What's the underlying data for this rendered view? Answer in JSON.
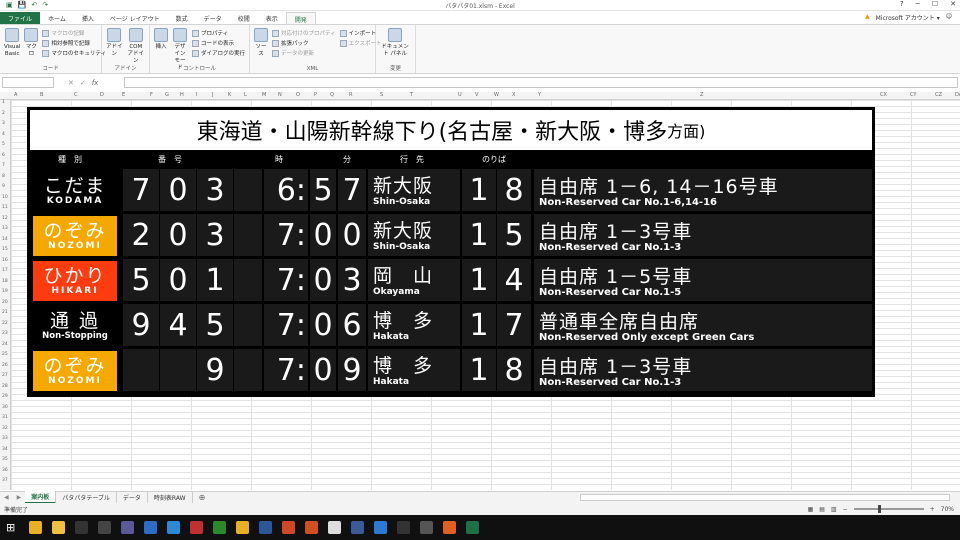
{
  "window": {
    "title": "パタパタ01.xlsm - Excel",
    "controls": [
      "?",
      "─",
      "☐",
      "✕"
    ]
  },
  "ribbon_tabs": [
    "ファイル",
    "ホーム",
    "挿入",
    "ページ レイアウト",
    "数式",
    "データ",
    "校閲",
    "表示",
    "開発"
  ],
  "account": {
    "warn": "▲",
    "label": "Microsoft アカウント ▾",
    "smiley": "☺"
  },
  "ribbon": {
    "code": {
      "label": "コード",
      "vb": "Visual Basic",
      "macro": "マクロ",
      "record": "マクロの記録",
      "relative": "相対参照で記録",
      "security": "マクロのセキュリティ"
    },
    "addin": {
      "label": "アドイン",
      "addin_btn": "アドイン",
      "com_btn": "COM アドイン"
    },
    "controls": {
      "label": "コントロール",
      "insert": "挿入",
      "design": "デザイン モード",
      "property": "プロパティ",
      "viewcode": "コードの表示",
      "dialog": "ダイアログの実行"
    },
    "xml": {
      "label": "XML",
      "source": "ソース",
      "mapprop": "対応付けのプロパティ",
      "expand": "拡張パック",
      "refresh": "データの更新",
      "import": "インポート",
      "export": "エクスポート"
    },
    "modify": {
      "label": "変更",
      "docpanel": "ドキュメント パネル"
    }
  },
  "formula_bar": {
    "fx": "fx",
    "cancel": "✕",
    "enter": "✓"
  },
  "columns": [
    "A",
    "B",
    "C",
    "D",
    "E",
    "F",
    "G",
    "H",
    "I",
    "J",
    "K",
    "L",
    "M",
    "N",
    "O",
    "P",
    "Q",
    "R",
    "S",
    "T",
    "U",
    "V",
    "W",
    "X",
    "Y",
    "Z",
    "CX",
    "CY",
    "CZ",
    "DA"
  ],
  "rows": [
    "1",
    "2",
    "3",
    "4",
    "5",
    "6",
    "7",
    "8",
    "9",
    "10",
    "11",
    "12",
    "13",
    "14",
    "15",
    "16",
    "17",
    "18",
    "19",
    "20",
    "21",
    "22",
    "23",
    "24",
    "25",
    "26",
    "27",
    "28",
    "29",
    "30",
    "31",
    "32",
    "33",
    "34",
    "35",
    "36",
    "37"
  ],
  "board": {
    "title": "東海道・山陽新幹線下り(名古屋・新大阪・博多",
    "title_suffix": "方面)",
    "headers": {
      "type": "種　別",
      "number": "番　号",
      "hour": "時",
      "minute": "分",
      "dest": "行　先",
      "track": "のりば"
    },
    "trains": [
      {
        "type_jp": "こだま",
        "type_en": "KODAMA",
        "type_color": "#000000",
        "num": [
          "7",
          "0",
          "3"
        ],
        "hour": "6:",
        "min": [
          "5",
          "7"
        ],
        "dest_jp": "新大阪",
        "dest_en": "Shin-Osaka",
        "track": [
          "1",
          "8"
        ],
        "car_jp": "自由席 1－6, 14－16号車",
        "car_en": "Non-Reserved Car No.1-6,14-16"
      },
      {
        "type_jp": "のぞみ",
        "type_en": "NOZOMI",
        "type_color": "#f5a800",
        "num": [
          "2",
          "0",
          "3"
        ],
        "hour": "7:",
        "min": [
          "0",
          "0"
        ],
        "dest_jp": "新大阪",
        "dest_en": "Shin-Osaka",
        "track": [
          "1",
          "5"
        ],
        "car_jp": "自由席 1－3号車",
        "car_en": "Non-Reserved Car No.1-3"
      },
      {
        "type_jp": "ひかり",
        "type_en": "HIKARI",
        "type_color": "#ff3b10",
        "num": [
          "5",
          "0",
          "1"
        ],
        "hour": "7:",
        "min": [
          "0",
          "3"
        ],
        "dest_jp": "岡　山",
        "dest_en": "Okayama",
        "track": [
          "1",
          "4"
        ],
        "car_jp": "自由席 1－5号車",
        "car_en": "Non-Reserved Car No.1-5"
      },
      {
        "type_jp": "通 過",
        "type_en": "Non-Stopping",
        "type_color": "#000000",
        "num": [
          "9",
          "4",
          "5"
        ],
        "hour": "7:",
        "min": [
          "0",
          "6"
        ],
        "dest_jp": "博　多",
        "dest_en": "Hakata",
        "track": [
          "1",
          "7"
        ],
        "car_jp": "普通車全席自由席",
        "car_en": "Non-Reserved Only except Green Cars"
      },
      {
        "type_jp": "のぞみ",
        "type_en": "NOZOMI",
        "type_color": "#f5a800",
        "num": [
          "",
          "",
          "9"
        ],
        "hour": "7:",
        "min": [
          "0",
          "9"
        ],
        "dest_jp": "博　多",
        "dest_en": "Hakata",
        "track": [
          "1",
          "8"
        ],
        "car_jp": "自由席 1－3号車",
        "car_en": "Non-Reserved Car No.1-3"
      }
    ]
  },
  "sheets": [
    "案内板",
    "パタパタテーブル",
    "データ",
    "時刻表RAW"
  ],
  "active_sheet": "案内板",
  "status": {
    "ready": "準備完了",
    "zoom": "70%"
  },
  "taskbar_icons": [
    "windows-icon",
    "chrome-icon",
    "explorer-icon",
    "terminal-icon",
    "film-icon",
    "people-icon",
    "edge-icon",
    "photos-icon",
    "app-icon",
    "greenshot-icon",
    "chrome-icon",
    "word-icon",
    "powerpoint-icon",
    "game-icon",
    "doc-icon",
    "vm-icon",
    "vscode-icon",
    "steam-icon",
    "obs-icon",
    "media-icon",
    "excel-icon"
  ]
}
